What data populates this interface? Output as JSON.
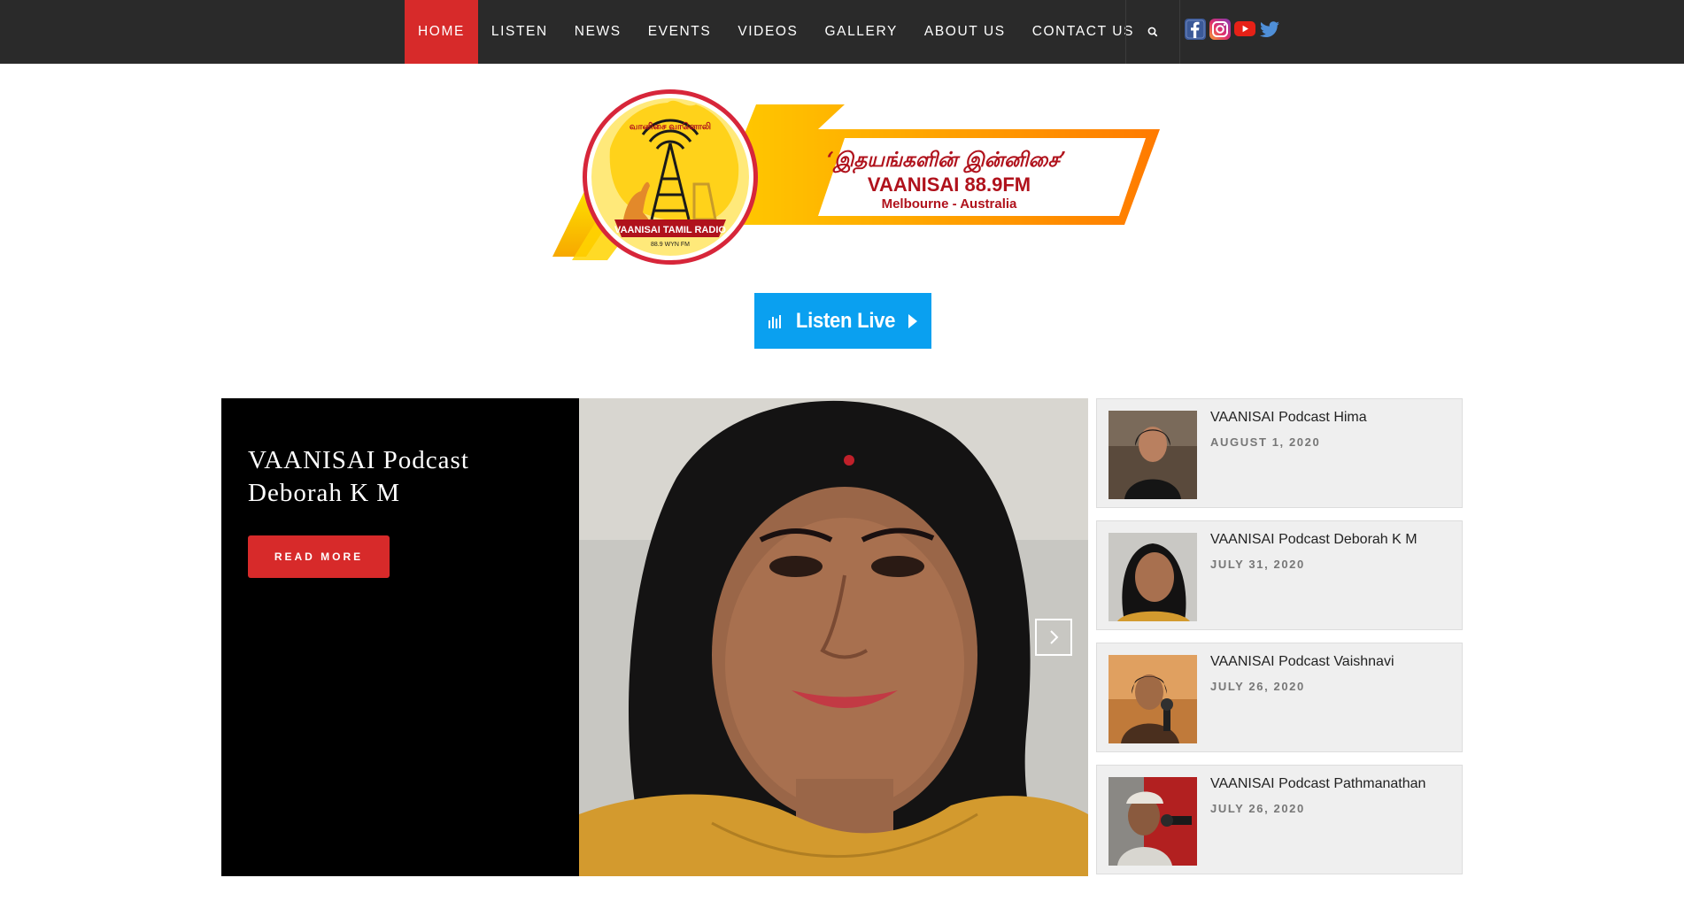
{
  "nav": {
    "items": [
      {
        "label": "HOME"
      },
      {
        "label": "LISTEN"
      },
      {
        "label": "NEWS"
      },
      {
        "label": "EVENTS"
      },
      {
        "label": "VIDEOS"
      },
      {
        "label": "GALLERY"
      },
      {
        "label": "ABOUT US"
      },
      {
        "label": "CONTACT US"
      }
    ],
    "active": "HOME",
    "search_icon": "search-icon",
    "social_icons": [
      "facebook-icon",
      "instagram-icon",
      "youtube-icon",
      "twitter-icon"
    ],
    "colors": {
      "bar": "#2a2a2a",
      "active": "#d72a2a"
    }
  },
  "logo": {
    "tagline": "‘இதயங்களின் இன்னிசை’",
    "station": "VAANISAI 88.9FM",
    "location": "Melbourne - Australia",
    "ring_text": "வானிசை வானொலி",
    "badge": "VAANISAI TAMIL RADIO",
    "badge_sub": "88.9 WYN FM"
  },
  "listen_live": {
    "label": "Listen Live",
    "color": "#0aa0f0"
  },
  "featured": {
    "title": "VAANISAI Podcast Deborah K M",
    "read_more": "READ MORE"
  },
  "podcasts": [
    {
      "title": "VAANISAI Podcast Hima",
      "date": "AUGUST 1, 2020"
    },
    {
      "title": "VAANISAI Podcast Deborah K M",
      "date": "JULY 31, 2020"
    },
    {
      "title": "VAANISAI Podcast Vaishnavi",
      "date": "JULY 26, 2020"
    },
    {
      "title": "VAANISAI Podcast Pathmanathan",
      "date": "JULY 26, 2020"
    }
  ]
}
